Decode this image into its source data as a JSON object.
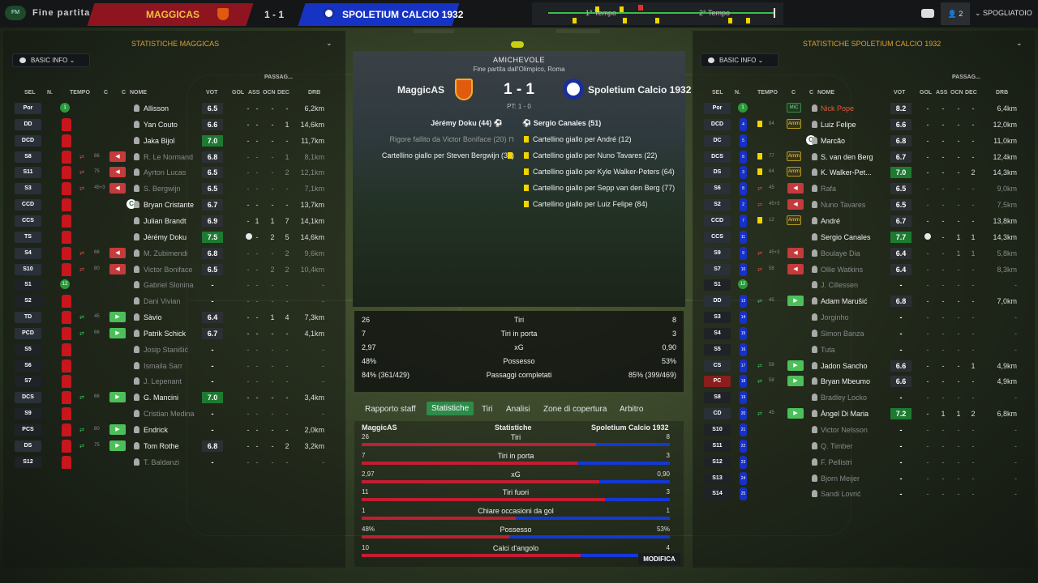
{
  "topbar": {
    "title": "Fine partita",
    "home_team": "MAGGICAS",
    "score": "1 - 1",
    "away_team": "SPOLETIUM CALCIO 1932",
    "half1": "1° Tempo",
    "half2": "2° Tempo",
    "users": "2",
    "spogliatoio": "SPOGLIATOIO",
    "logo": "FM"
  },
  "left": {
    "title": "STATISTICHE MAGGICAS",
    "basic": "BASIC INFO"
  },
  "right": {
    "title": "STATISTICHE SPOLETIUM CALCIO 1932",
    "basic": "BASIC INFO"
  },
  "headers": {
    "sel": "SEL",
    "n": "N.",
    "tempo": "TEMPO",
    "c1": "C",
    "c2": "C",
    "nome": "NOME",
    "vot": "VOT",
    "gol": "GOL",
    "passaggi": "PASSAG...",
    "ass": "ASS",
    "ocn": "OCN",
    "dec": "DEC",
    "drb": "DRB"
  },
  "center": {
    "competition": "AMICHEVOLE",
    "venue": "Fine partita dall'Olimpico, Roma",
    "home": "MaggicAS",
    "away": "Spoletium Calcio 1932",
    "score": "1 - 1",
    "ht": "PT: 1 - 0",
    "events": {
      "home_goal": "Jérémy Doku (44)",
      "away_goal": "Sergio Canales (51)",
      "home_miss": "Rigore fallito da Victor Boniface (20)",
      "home_card": "Cartellino giallo per Steven Bergwijn (33)",
      "away_cards": [
        "Cartellino giallo per André (12)",
        "Cartellino giallo per Nuno Tavares (22)",
        "Cartellino giallo per Kyle Walker-Peters (64)",
        "Cartellino giallo per Sepp van den Berg (77)",
        "Cartellino giallo per Luiz Felipe (84)"
      ]
    },
    "summary": [
      {
        "l": "26",
        "label": "Tiri",
        "r": "8"
      },
      {
        "l": "7",
        "label": "Tiri in porta",
        "r": "3"
      },
      {
        "l": "2,97",
        "label": "xG",
        "r": "0,90"
      },
      {
        "l": "48%",
        "label": "Possesso",
        "r": "53%"
      },
      {
        "l": "84% (361/429)",
        "label": "Passaggi completati",
        "r": "85% (399/469)"
      }
    ],
    "tabs": [
      "Rapporto staff",
      "Statistiche",
      "Tiri",
      "Analisi",
      "Zone di copertura",
      "Arbitro"
    ],
    "cmp_home": "MaggicAS",
    "cmp_title": "Statistiche",
    "cmp_away": "Spoletium Calcio 1932",
    "cmp": [
      {
        "l": "26",
        "label": "Tiri",
        "r": "8",
        "h": 0.76,
        "a": 0.24
      },
      {
        "l": "7",
        "label": "Tiri in porta",
        "r": "3",
        "h": 0.7,
        "a": 0.3
      },
      {
        "l": "2,97",
        "label": "xG",
        "r": "0,90",
        "h": 0.77,
        "a": 0.23
      },
      {
        "l": "11",
        "label": "Tiri fuori",
        "r": "3",
        "h": 0.79,
        "a": 0.21
      },
      {
        "l": "1",
        "label": "Chiare occasioni da gol",
        "r": "1",
        "h": 0.5,
        "a": 0.5
      },
      {
        "l": "48%",
        "label": "Possesso",
        "r": "53%",
        "h": 0.48,
        "a": 0.52
      },
      {
        "l": "10",
        "label": "Calci d'angolo",
        "r": "4",
        "h": 0.71,
        "a": 0.29
      }
    ],
    "modifica": "MODIFICA"
  },
  "home_players": [
    {
      "pos": "Por",
      "name": "Allisson",
      "vot": "6.5",
      "gol": "-",
      "ass": "-",
      "ocn": "-",
      "dec": "-",
      "drb": "6,2km",
      "gk": true
    },
    {
      "pos": "DD",
      "name": "Yan Couto",
      "vot": "6.6",
      "gol": "-",
      "ass": "-",
      "ocn": "-",
      "dec": "1",
      "drb": "14,6km"
    },
    {
      "pos": "DCD",
      "name": "Jaka Bijol",
      "vot": "7.0",
      "gol": "-",
      "ass": "-",
      "ocn": "-",
      "dec": "-",
      "drb": "11,7km",
      "good": true
    },
    {
      "pos": "S8",
      "name": "R. Le Normand",
      "vot": "6.8",
      "gol": "-",
      "ass": "-",
      "ocn": "-",
      "dec": "1",
      "drb": "8,1km",
      "dim": true,
      "min": "66",
      "sub": "out"
    },
    {
      "pos": "S11",
      "name": "Ayrton Lucas",
      "vot": "6.5",
      "gol": "-",
      "ass": "-",
      "ocn": "-",
      "dec": "2",
      "drb": "12,1km",
      "dim": true,
      "min": "75",
      "sub": "out"
    },
    {
      "pos": "S3",
      "name": "S. Bergwijn",
      "vot": "6.5",
      "gol": "-",
      "ass": "-",
      "ocn": "-",
      "dec": "-",
      "drb": "7,1km",
      "dim": true,
      "min": "45+3",
      "sub": "out"
    },
    {
      "pos": "CCD",
      "name": "Bryan Cristante",
      "vot": "6.7",
      "gol": "-",
      "ass": "-",
      "ocn": "-",
      "dec": "-",
      "drb": "13,7km",
      "capt": true
    },
    {
      "pos": "CCS",
      "name": "Julian Brandt",
      "vot": "6.9",
      "gol": "-",
      "ass": "1",
      "ocn": "1",
      "dec": "7",
      "drb": "14,1km"
    },
    {
      "pos": "TS",
      "name": "Jérémy Doku",
      "vot": "7.5",
      "gol": "ball",
      "ass": "-",
      "ocn": "2",
      "dec": "5",
      "drb": "14,6km",
      "good": true
    },
    {
      "pos": "S4",
      "name": "M. Zubimendi",
      "vot": "6.8",
      "gol": "-",
      "ass": "-",
      "ocn": "-",
      "dec": "2",
      "drb": "9,6km",
      "dim": true,
      "min": "66",
      "sub": "out"
    },
    {
      "pos": "S10",
      "name": "Victor Boniface",
      "vot": "6.5",
      "gol": "-",
      "ass": "-",
      "ocn": "2",
      "dec": "2",
      "drb": "10,4km",
      "dim": true,
      "min": "80",
      "sub": "out"
    },
    {
      "pos": "S1",
      "name": "Gabriel Slonina",
      "vot": "-",
      "gol": "-",
      "ass": "-",
      "ocn": "-",
      "dec": "-",
      "drb": "-",
      "dim": true,
      "gkn": true
    },
    {
      "pos": "S2",
      "name": "Dani Vivian",
      "vot": "-",
      "gol": "-",
      "ass": "-",
      "ocn": "-",
      "dec": "-",
      "drb": "-",
      "dim": true
    },
    {
      "pos": "TD",
      "name": "Sàvio",
      "vot": "6.4",
      "gol": "-",
      "ass": "-",
      "ocn": "1",
      "dec": "4",
      "drb": "7,3km",
      "min": "45",
      "sub": "in"
    },
    {
      "pos": "PCD",
      "name": "Patrik Schick",
      "vot": "6.7",
      "gol": "-",
      "ass": "-",
      "ocn": "-",
      "dec": "-",
      "drb": "4,1km",
      "min": "66",
      "sub": "in"
    },
    {
      "pos": "S5",
      "name": "Josip Stanišić",
      "vot": "-",
      "gol": "-",
      "ass": "-",
      "ocn": "-",
      "dec": "-",
      "drb": "-",
      "dim": true
    },
    {
      "pos": "S6",
      "name": "Ismaila Sarr",
      "vot": "-",
      "gol": "-",
      "ass": "-",
      "ocn": "-",
      "dec": "-",
      "drb": "-",
      "dim": true
    },
    {
      "pos": "S7",
      "name": "J. Lepenant",
      "vot": "-",
      "gol": "-",
      "ass": "-",
      "ocn": "-",
      "dec": "-",
      "drb": "-",
      "dim": true
    },
    {
      "pos": "DCS",
      "name": "G. Mancini",
      "vot": "7.0",
      "gol": "-",
      "ass": "-",
      "ocn": "-",
      "dec": "-",
      "drb": "3,4km",
      "good": true,
      "min": "66",
      "sub": "in"
    },
    {
      "pos": "S9",
      "name": "Cristian Medina",
      "vot": "-",
      "gol": "-",
      "ass": "-",
      "ocn": "-",
      "dec": "-",
      "drb": "-",
      "dim": true
    },
    {
      "pos": "PCS",
      "name": "Endrick",
      "vot": "-",
      "gol": "-",
      "ass": "-",
      "ocn": "-",
      "dec": "-",
      "drb": "2,0km",
      "min": "80",
      "sub": "in"
    },
    {
      "pos": "DS",
      "name": "Tom Rothe",
      "vot": "6.8",
      "gol": "-",
      "ass": "-",
      "ocn": "-",
      "dec": "2",
      "drb": "3,2km",
      "min": "75",
      "sub": "in"
    },
    {
      "pos": "S12",
      "name": "T. Baldanzi",
      "vot": "-",
      "gol": "-",
      "ass": "-",
      "ocn": "-",
      "dec": "-",
      "drb": "-",
      "dim": true
    }
  ],
  "away_players": [
    {
      "pos": "Por",
      "n": "1",
      "name": "Nick Pope",
      "vot": "8.2",
      "gol": "-",
      "ass": "-",
      "ocn": "-",
      "dec": "-",
      "drb": "6,4km",
      "gk": true,
      "capt": "MiC",
      "best": true
    },
    {
      "pos": "DCD",
      "n": "4",
      "name": "Luiz Felipe",
      "vot": "6.6",
      "gol": "-",
      "ass": "-",
      "ocn": "-",
      "dec": "-",
      "drb": "12,0km",
      "card": true,
      "min": "84",
      "capt": "Amm"
    },
    {
      "pos": "DC",
      "n": "5",
      "name": "Marcão",
      "vot": "6.8",
      "gol": "-",
      "ass": "-",
      "ocn": "-",
      "dec": "-",
      "drb": "11,0km",
      "bigc": true
    },
    {
      "pos": "DCS",
      "n": "6",
      "name": "S. van den Berg",
      "vot": "6.7",
      "gol": "-",
      "ass": "-",
      "ocn": "-",
      "dec": "-",
      "drb": "12,4km",
      "card": true,
      "min": "77",
      "capt": "Amm"
    },
    {
      "pos": "DS",
      "n": "3",
      "name": "K. Walker-Pet...",
      "vot": "7.0",
      "gol": "-",
      "ass": "-",
      "ocn": "-",
      "dec": "2",
      "drb": "14,3km",
      "card": true,
      "min": "64",
      "capt": "Amm",
      "good": true
    },
    {
      "pos": "S6",
      "n": "8",
      "name": "Rafa",
      "vot": "6.5",
      "gol": "-",
      "ass": "-",
      "ocn": "-",
      "dec": "-",
      "drb": "9,0km",
      "dim": true,
      "min": "45",
      "sub": "out"
    },
    {
      "pos": "S2",
      "n": "2",
      "name": "Nuno Tavares",
      "vot": "6.5",
      "gol": "-",
      "ass": "-",
      "ocn": "-",
      "dec": "-",
      "drb": "7,5km",
      "dim": true,
      "min": "45+3",
      "sub": "out",
      "card": true
    },
    {
      "pos": "CCD",
      "n": "7",
      "name": "André",
      "vot": "6.7",
      "gol": "-",
      "ass": "-",
      "ocn": "-",
      "dec": "-",
      "drb": "13,8km",
      "card": true,
      "min": "12",
      "capt": "Amm"
    },
    {
      "pos": "CCS",
      "n": "11",
      "name": "Sergio Canales",
      "vot": "7.7",
      "gol": "ball",
      "ass": "-",
      "ocn": "1",
      "dec": "1",
      "drb": "14,3km",
      "good": true
    },
    {
      "pos": "S9",
      "n": "9",
      "name": "Boulaye Dia",
      "vot": "6.4",
      "gol": "-",
      "ass": "-",
      "ocn": "1",
      "dec": "1",
      "drb": "5,8km",
      "dim": true,
      "min": "45+3",
      "sub": "out"
    },
    {
      "pos": "S7",
      "n": "10",
      "name": "Ollie Watkins",
      "vot": "6.4",
      "gol": "-",
      "ass": "-",
      "ocn": "-",
      "dec": "-",
      "drb": "8,3km",
      "dim": true,
      "min": "58",
      "sub": "out"
    },
    {
      "pos": "S1",
      "n": "12",
      "name": "J. Cillessen",
      "vot": "-",
      "gol": "-",
      "ass": "-",
      "ocn": "-",
      "dec": "-",
      "drb": "-",
      "dim": true,
      "gkn": true
    },
    {
      "pos": "DD",
      "n": "13",
      "name": "Adam Marušić",
      "vot": "6.8",
      "gol": "-",
      "ass": "-",
      "ocn": "-",
      "dec": "-",
      "drb": "7,0km",
      "min": "45",
      "sub": "in"
    },
    {
      "pos": "S3",
      "n": "14",
      "name": "Jorginho",
      "vot": "-",
      "gol": "-",
      "ass": "-",
      "ocn": "-",
      "dec": "-",
      "drb": "-",
      "dim": true
    },
    {
      "pos": "S4",
      "n": "15",
      "name": "Simon Banza",
      "vot": "-",
      "gol": "-",
      "ass": "-",
      "ocn": "-",
      "dec": "-",
      "drb": "-",
      "dim": true
    },
    {
      "pos": "S5",
      "n": "16",
      "name": "Tuta",
      "vot": "-",
      "gol": "-",
      "ass": "-",
      "ocn": "-",
      "dec": "-",
      "drb": "-",
      "dim": true
    },
    {
      "pos": "CS",
      "n": "17",
      "name": "Jadon Sancho",
      "vot": "6.6",
      "gol": "-",
      "ass": "-",
      "ocn": "-",
      "dec": "1",
      "drb": "4,9km",
      "min": "58",
      "sub": "in"
    },
    {
      "pos": "PC",
      "n": "18",
      "name": "Bryan Mbeumo",
      "vot": "6.6",
      "gol": "-",
      "ass": "-",
      "ocn": "-",
      "dec": "-",
      "drb": "4,9km",
      "min": "58",
      "sub": "in",
      "red": true
    },
    {
      "pos": "S8",
      "n": "19",
      "name": "Bradley Locko",
      "vot": "-",
      "gol": "-",
      "ass": "-",
      "ocn": "-",
      "dec": "-",
      "drb": "-",
      "dim": true
    },
    {
      "pos": "CD",
      "n": "20",
      "name": "Àngel Di Maria",
      "vot": "7.2",
      "gol": "-",
      "ass": "1",
      "ocn": "1",
      "dec": "2",
      "drb": "6,8km",
      "good": true,
      "min": "45",
      "sub": "in"
    },
    {
      "pos": "S10",
      "n": "21",
      "name": "Victor Nelsson",
      "vot": "-",
      "gol": "-",
      "ass": "-",
      "ocn": "-",
      "dec": "-",
      "drb": "-",
      "dim": true
    },
    {
      "pos": "S11",
      "n": "22",
      "name": "Q. Timber",
      "vot": "-",
      "gol": "-",
      "ass": "-",
      "ocn": "-",
      "dec": "-",
      "drb": "-",
      "dim": true
    },
    {
      "pos": "S12",
      "n": "23",
      "name": "F. Pellistri",
      "vot": "-",
      "gol": "-",
      "ass": "-",
      "ocn": "-",
      "dec": "-",
      "drb": "-",
      "dim": true
    },
    {
      "pos": "S13",
      "n": "24",
      "name": "Bjorn Meijer",
      "vot": "-",
      "gol": "-",
      "ass": "-",
      "ocn": "-",
      "dec": "-",
      "drb": "-",
      "dim": true
    },
    {
      "pos": "S14",
      "n": "25",
      "name": "Sandi Lovrić",
      "vot": "-",
      "gol": "-",
      "ass": "-",
      "ocn": "-",
      "dec": "-",
      "drb": "-",
      "dim": true
    }
  ],
  "colors": {
    "home": "#c8161d",
    "away": "#1730c8",
    "accent": "#2e8b4a",
    "card": "#f2d400"
  }
}
